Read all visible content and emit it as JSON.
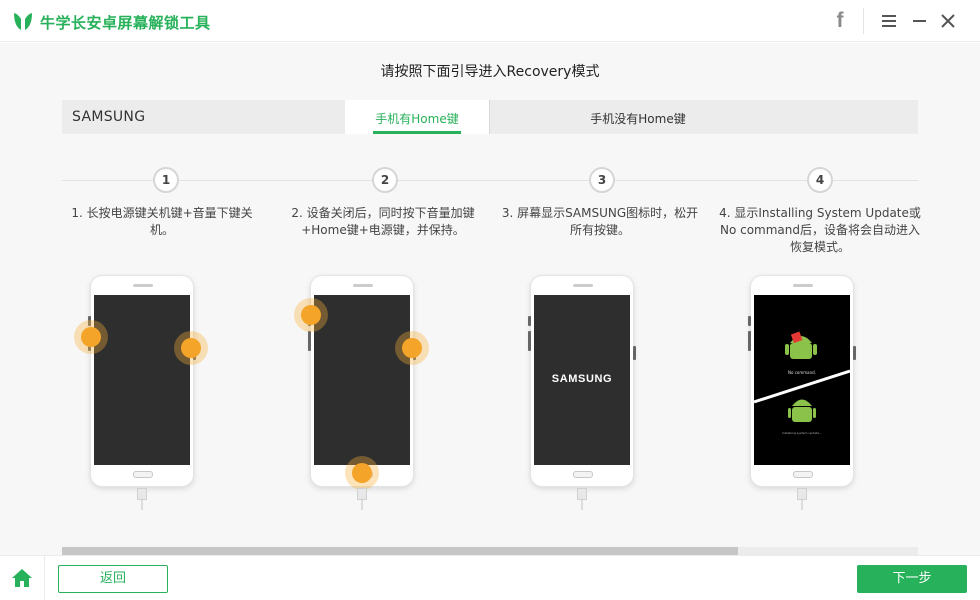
{
  "app": {
    "title": "牛学长安卓屏幕解锁工具",
    "accent": "#27b15a"
  },
  "header_icons": {
    "facebook": "f"
  },
  "instruction": "请按照下面引导进入Recovery模式",
  "brand": "SAMSUNG",
  "tabs": [
    {
      "label": "手机有Home键",
      "active": true
    },
    {
      "label": "手机没有Home键",
      "active": false
    }
  ],
  "steps": [
    {
      "num": "1",
      "line1": "1. 长按电源键关机键+音量下键关",
      "line2": "机。",
      "line3": ""
    },
    {
      "num": "2",
      "line1": "2. 设备关闭后，同时按下音量加键",
      "line2": "+Home键+电源键，并保持。",
      "line3": ""
    },
    {
      "num": "3",
      "line1": "3. 屏幕显示SAMSUNG图标时，松开",
      "line2": "所有按键。",
      "line3": ""
    },
    {
      "num": "4",
      "line1": "4. 显示Installing System Update或",
      "line2": "No command后，设备将会自动进入",
      "line3": "恢复模式。"
    }
  ],
  "phone3": {
    "logo": "SAMSUNG"
  },
  "phone4": {
    "no_command": "No command.",
    "installing": "Installing system update..."
  },
  "scroll": {
    "position": 0.79
  },
  "footer": {
    "back": "返回",
    "next": "下一步"
  }
}
